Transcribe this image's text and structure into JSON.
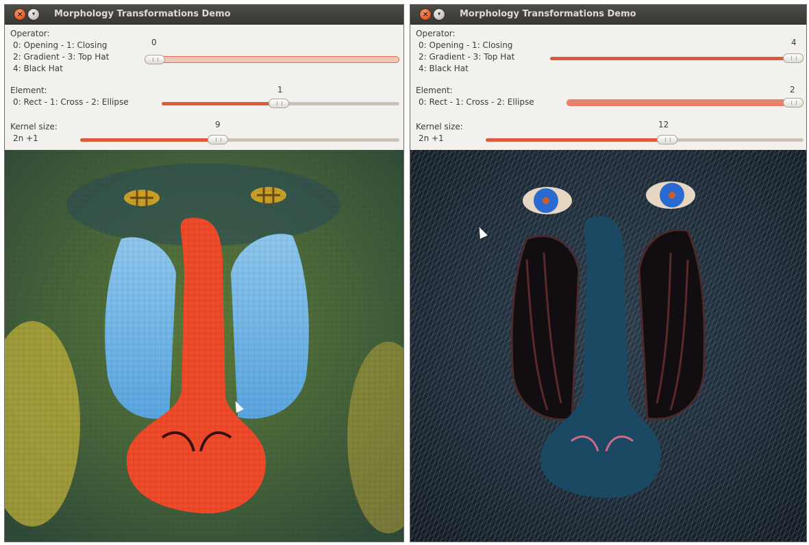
{
  "windows": [
    {
      "title": "Morphology Transformations Demo",
      "operator": {
        "label": "Operator:",
        "lines": [
          "0: Opening - 1: Closing",
          "2: Gradient - 3: Top Hat",
          "4: Black Hat"
        ],
        "value": "0",
        "level": 0.0
      },
      "element": {
        "label": "Element:",
        "lines": [
          "0: Rect - 1: Cross - 2: Ellipse"
        ],
        "value": "1",
        "level": 0.5
      },
      "kernel": {
        "label": "Kernel size:",
        "lines": [
          "2n +1"
        ],
        "value": "9",
        "level": 0.43
      },
      "image_description": "mandrill-closing-result"
    },
    {
      "title": "Morphology Transformations Demo",
      "operator": {
        "label": "Operator:",
        "lines": [
          "0: Opening - 1: Closing",
          "2: Gradient - 3: Top Hat",
          "4: Black Hat"
        ],
        "value": "4",
        "level": 1.0
      },
      "element": {
        "label": "Element:",
        "lines": [
          "0: Rect - 1: Cross - 2: Ellipse"
        ],
        "value": "2",
        "level": 1.0
      },
      "kernel": {
        "label": "Kernel size:",
        "lines": [
          "2n +1"
        ],
        "value": "12",
        "level": 0.57
      },
      "image_description": "mandrill-black-hat-result"
    }
  ],
  "colors": {
    "slider_fill": "#dd5a3c",
    "titlebar": "#3c3b37",
    "panel": "#f2f1ed"
  }
}
